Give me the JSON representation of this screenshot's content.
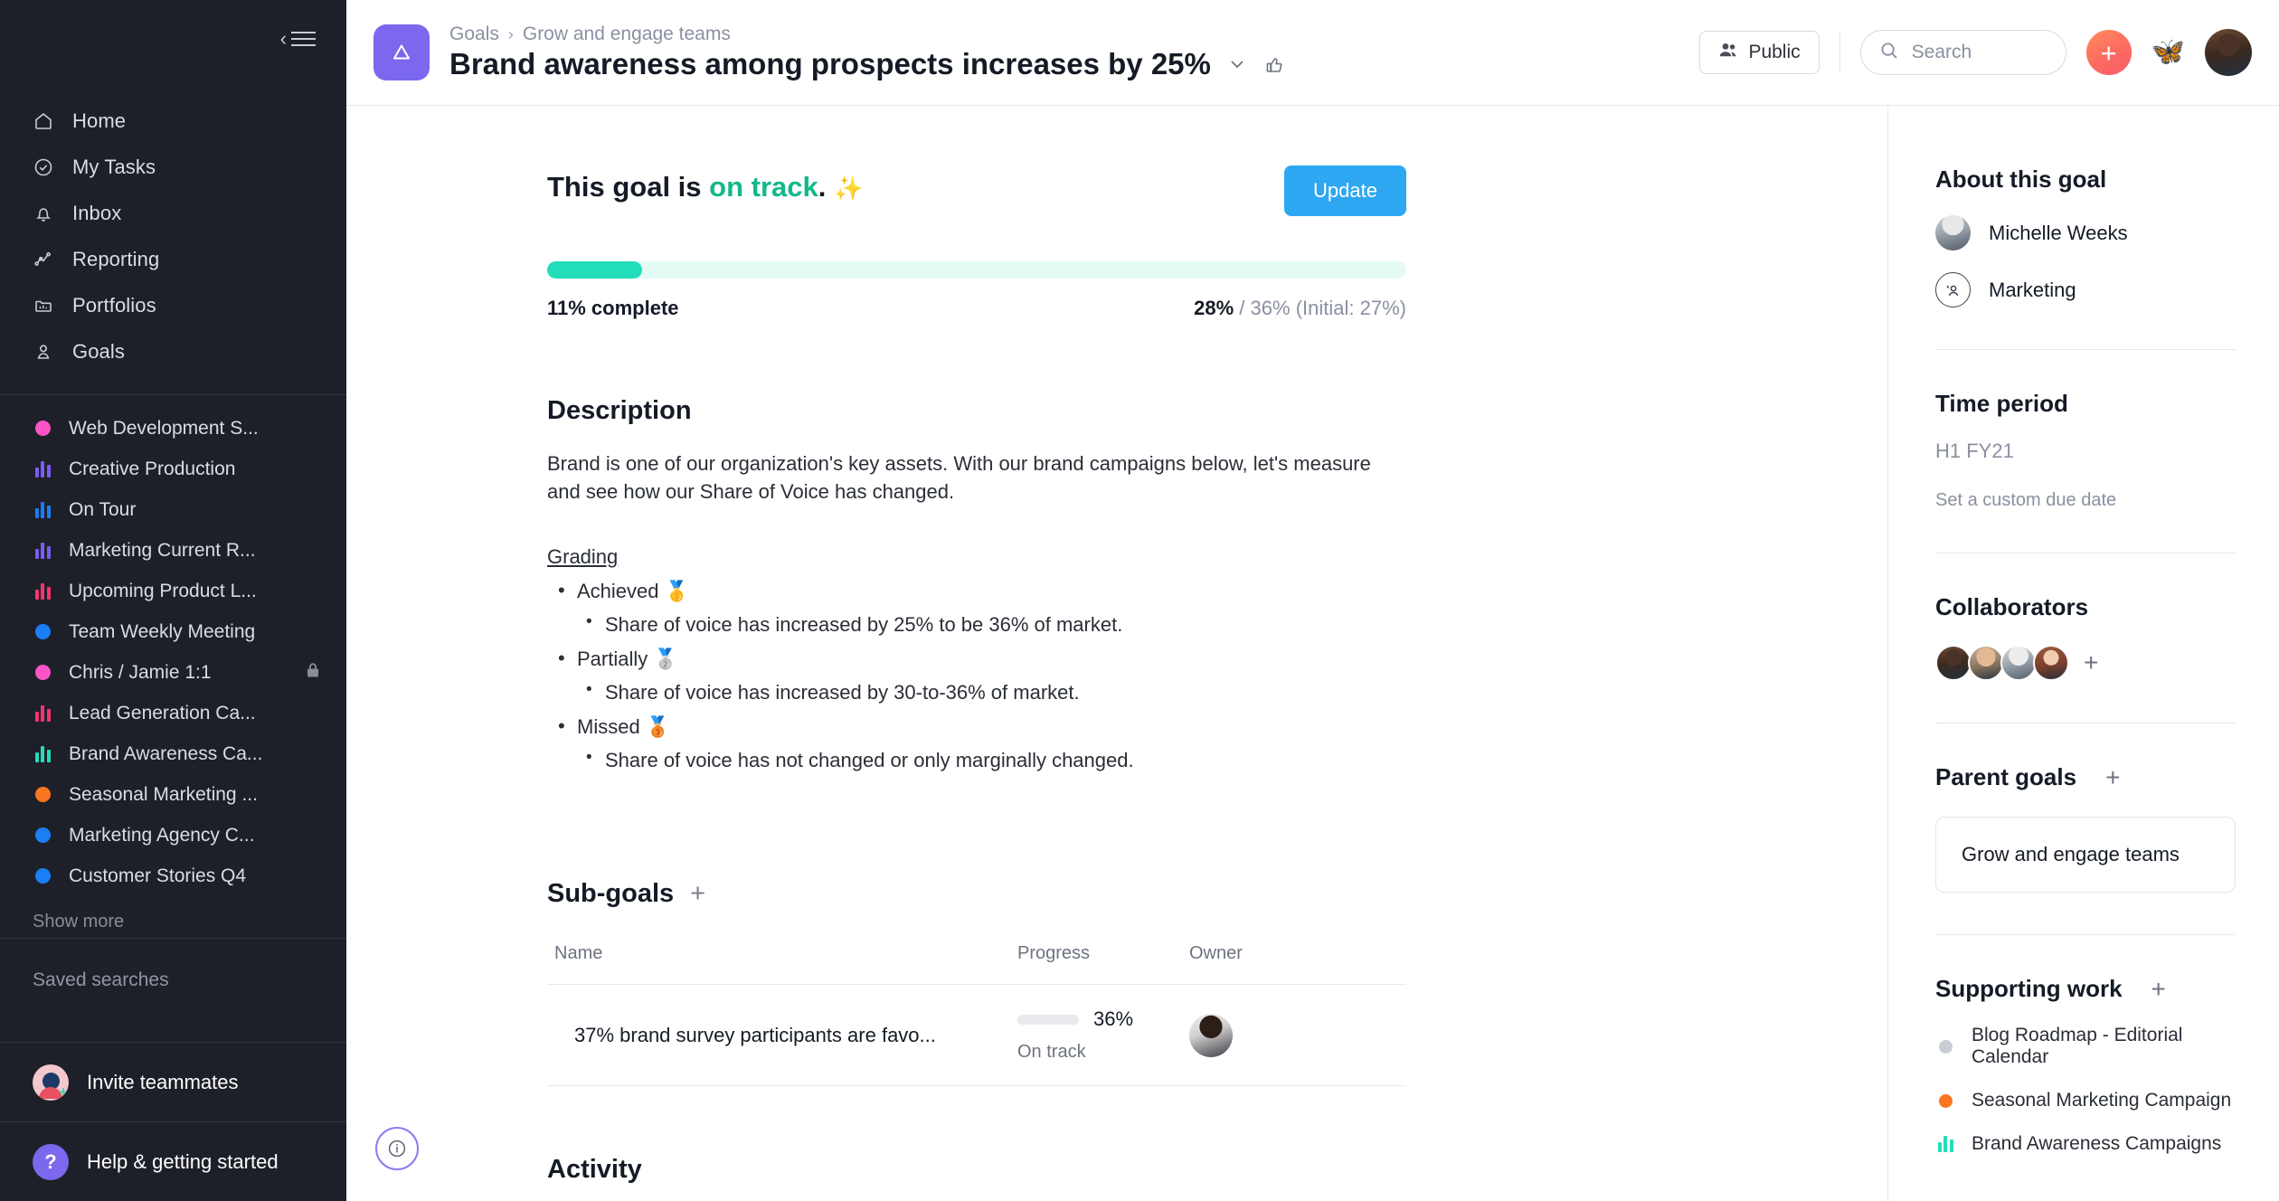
{
  "sidebar": {
    "nav": [
      {
        "label": "Home",
        "icon": "home-icon"
      },
      {
        "label": "My Tasks",
        "icon": "check-circle-icon"
      },
      {
        "label": "Inbox",
        "icon": "bell-icon"
      },
      {
        "label": "Reporting",
        "icon": "line-chart-icon"
      },
      {
        "label": "Portfolios",
        "icon": "portfolio-icon"
      },
      {
        "label": "Goals",
        "icon": "goals-icon"
      }
    ],
    "projects": [
      {
        "label": "Web Development S...",
        "icon": "dot",
        "color": "#fc54c8"
      },
      {
        "label": "Creative Production",
        "icon": "bars",
        "color": "#7b5cf5"
      },
      {
        "label": "On Tour",
        "icon": "bars",
        "color": "#1a7ef5"
      },
      {
        "label": "Marketing Current R...",
        "icon": "bars",
        "color": "#7b5cf5"
      },
      {
        "label": "Upcoming Product L...",
        "icon": "bars",
        "color": "#f7336e"
      },
      {
        "label": "Team Weekly Meeting",
        "icon": "dot",
        "color": "#1a7ef5"
      },
      {
        "label": "Chris / Jamie 1:1",
        "icon": "dot",
        "color": "#fc54c8",
        "lock": true
      },
      {
        "label": "Lead Generation Ca...",
        "icon": "bars",
        "color": "#f7336e"
      },
      {
        "label": "Brand Awareness Ca...",
        "icon": "bars",
        "color": "#22ddb9"
      },
      {
        "label": "Seasonal Marketing ...",
        "icon": "dot",
        "color": "#fa7621"
      },
      {
        "label": "Marketing Agency C...",
        "icon": "dot",
        "color": "#1a7ef5"
      },
      {
        "label": "Customer Stories Q4",
        "icon": "dot",
        "color": "#1a7ef5"
      }
    ],
    "show_more": "Show more",
    "saved_searches_title": "Saved searches",
    "invite_label": "Invite teammates",
    "help_label": "Help & getting started"
  },
  "topbar": {
    "breadcrumb": [
      "Goals",
      "Grow and engage teams"
    ],
    "breadcrumb_separator": "›",
    "title": "Brand awareness among prospects increases by 25%",
    "public_label": "Public",
    "search_placeholder": "Search",
    "search_value": "",
    "plus_label": "+"
  },
  "goal": {
    "status_prefix": "This goal is ",
    "status_value": "on track",
    "status_suffix": ".",
    "sparkle": "✨",
    "update_label": "Update",
    "progress_percent": 11,
    "complete_label": "11% complete",
    "current_value": "28%",
    "target_value": "36%",
    "initial_label": "(Initial: 27%)",
    "separator": "/"
  },
  "description": {
    "title": "Description",
    "body": "Brand is one of our organization's key assets. With our brand campaigns below, let's measure and see how our Share of Voice has changed.",
    "grading_label": "Grading",
    "grades": [
      {
        "label": "Achieved",
        "emoji": "🥇",
        "detail": "Share of voice has increased by 25% to be 36% of market."
      },
      {
        "label": "Partially",
        "emoji": "🥈",
        "detail": "Share of voice has increased by 30-to-36% of market."
      },
      {
        "label": "Missed",
        "emoji": "🥉",
        "detail": "Share of voice has not changed or only marginally changed."
      }
    ]
  },
  "subgoals": {
    "title": "Sub-goals",
    "columns": {
      "name": "Name",
      "progress": "Progress",
      "owner": "Owner"
    },
    "rows": [
      {
        "name": "37% brand survey participants are favo...",
        "progress_percent": 36,
        "progress_label": "36%",
        "status": "On track"
      }
    ]
  },
  "activity": {
    "title": "Activity"
  },
  "right_panel": {
    "about_title": "About this goal",
    "owner": "Michelle Weeks",
    "team": "Marketing",
    "time_period_title": "Time period",
    "time_period_value": "H1 FY21",
    "due_date_link": "Set a custom due date",
    "collaborators_title": "Collaborators",
    "collaborator_count": 4,
    "parent_goals_title": "Parent goals",
    "parent_goal": "Grow and engage teams",
    "supporting_title": "Supporting work",
    "supporting": [
      {
        "label": "Blog Roadmap - Editorial Calendar",
        "icon": "dot",
        "color": "#c9ced6"
      },
      {
        "label": "Seasonal Marketing Campaign",
        "icon": "dot",
        "color": "#fa7621"
      },
      {
        "label": "Brand Awareness Campaigns",
        "icon": "bars",
        "color": "#22ddb9"
      }
    ]
  },
  "colors": {
    "accent_teal": "#22ddb9",
    "accent_blue": "#2ea7f2",
    "brand_purple": "#7b68ee",
    "sidebar_bg": "#1e2029"
  }
}
